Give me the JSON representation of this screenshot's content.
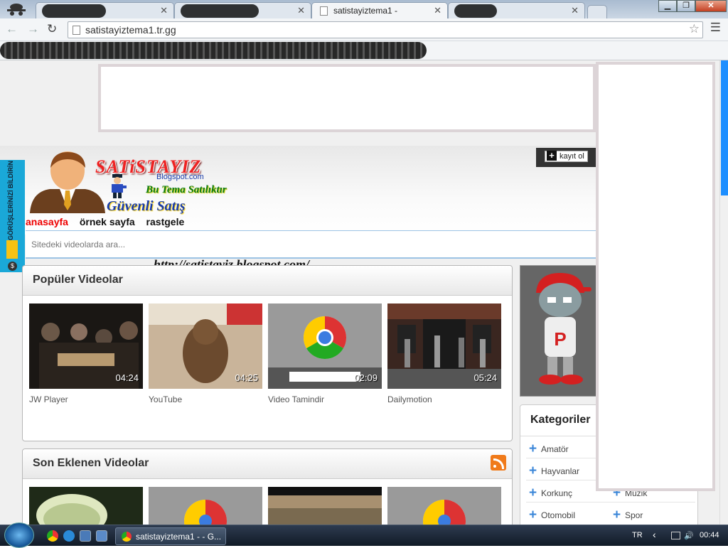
{
  "browser": {
    "active_tab_title": "satistayiztema1 -",
    "url": "satistayiztema1.tr.gg",
    "window_buttons": {
      "minimize": "▁",
      "maximize": "❐",
      "close": "✕"
    }
  },
  "site": {
    "logo_title": "SATiSTAYIZ",
    "logo_subtitle": "Blogspot.com",
    "logo_tagline": "Bu Tema Satılıktır",
    "logo_safe": "Güvenli Satış",
    "register_label": "kayıt ol",
    "menu": [
      {
        "label": "anasayfa",
        "active": true
      },
      {
        "label": "örnek sayfa",
        "active": false
      },
      {
        "label": "rastgele",
        "active": false
      }
    ],
    "search_placeholder": "Sitedeki videolarda ara...",
    "blog_url": "http://satistayiz.blogspot.com/",
    "feedback_label": "GÖRÜŞLERİNİZİ BİLDİRİN"
  },
  "popular": {
    "title": "Popüler Videolar",
    "videos": [
      {
        "title": "JW Player",
        "duration": "04:24"
      },
      {
        "title": "YouTube",
        "duration": "04:25"
      },
      {
        "title": "Video Tamindir",
        "duration": "02:09"
      },
      {
        "title": "Dailymotion",
        "duration": "05:24"
      }
    ]
  },
  "recent": {
    "title": "Son Eklenen Videolar"
  },
  "categories": {
    "title": "Kategoriler",
    "items": [
      {
        "label": "Amatör"
      },
      {
        "label": "Hayvanlar"
      },
      {
        "label": "Korkunç"
      },
      {
        "label": "Müzik"
      },
      {
        "label": "Otomobil"
      },
      {
        "label": "Spor"
      }
    ]
  },
  "taskbar": {
    "task_label": "satistayiztema1 - - G...",
    "language": "TR",
    "clock": "00:44"
  },
  "colors": {
    "accent": "#1e8fff",
    "menu_active": "#e00000",
    "feedback": "#1aa8d8"
  }
}
